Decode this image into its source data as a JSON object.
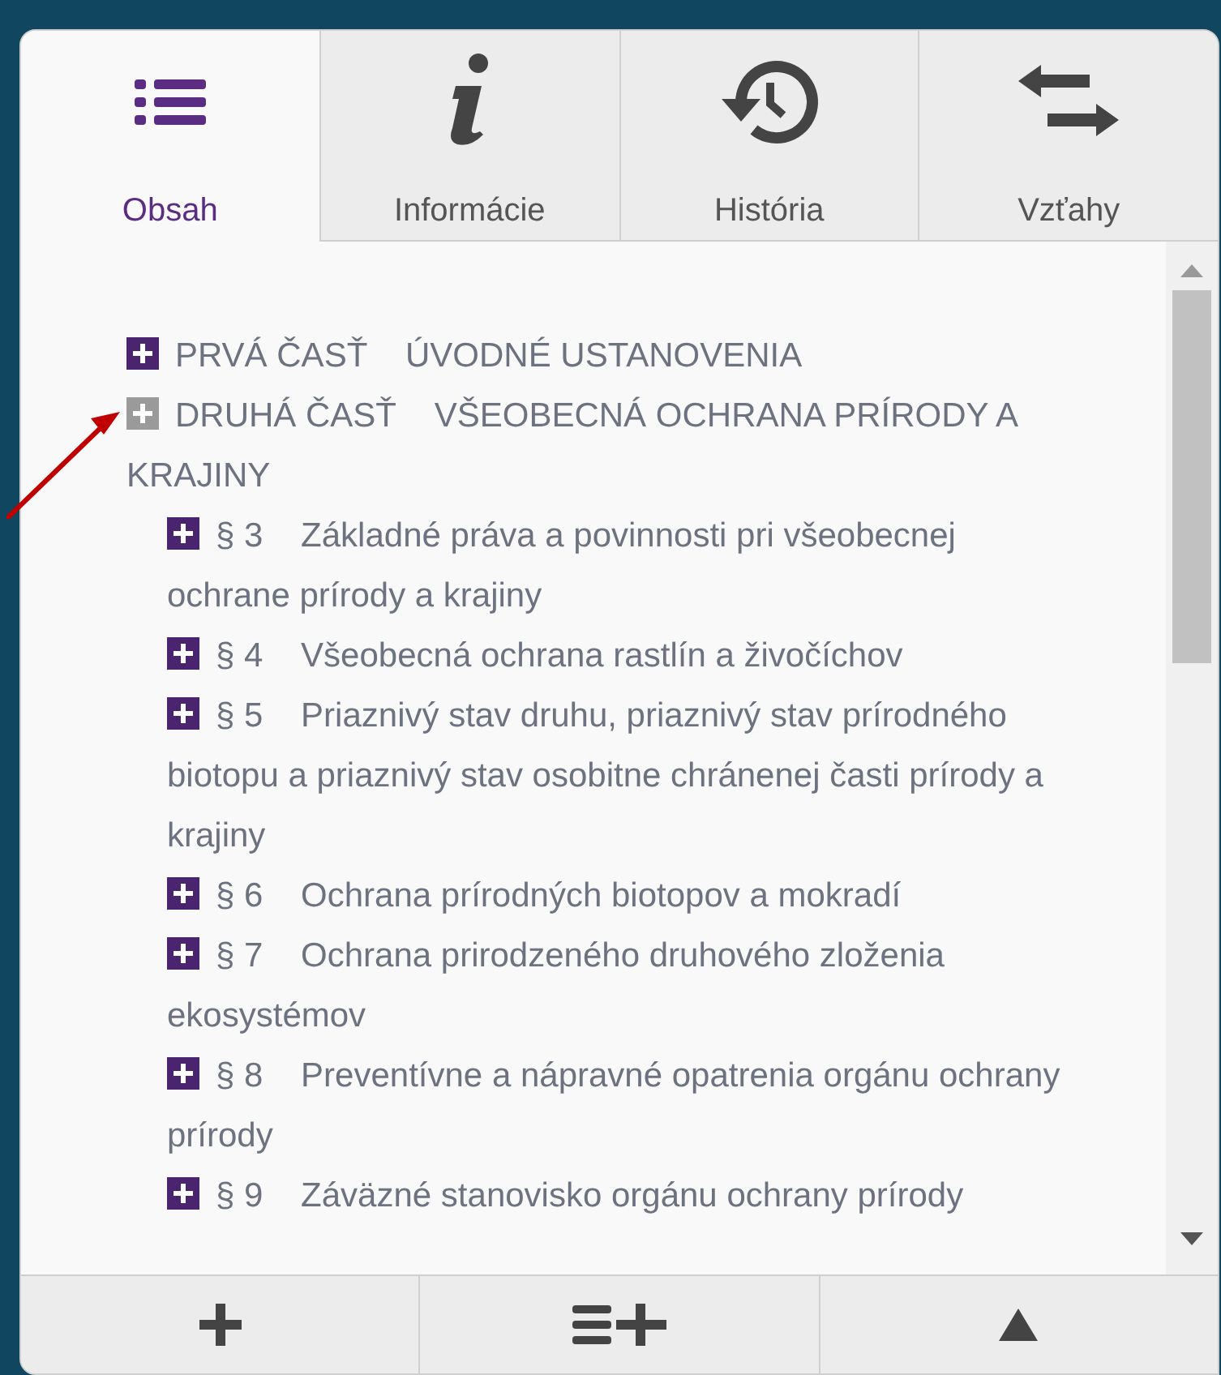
{
  "tabs": [
    {
      "label": "Obsah",
      "kind": "list",
      "selected": true
    },
    {
      "label": "Informácie",
      "kind": "info",
      "selected": false
    },
    {
      "label": "História",
      "kind": "history",
      "selected": false
    },
    {
      "label": "Vzťahy",
      "kind": "relations",
      "selected": false
    }
  ],
  "tree": [
    {
      "number": "PRVÁ ČASŤ",
      "title": "ÚVODNÉ USTANOVENIA",
      "expanded": false
    },
    {
      "number": "DRUHÁ ČASŤ",
      "title": "VŠEOBECNÁ OCHRANA PRÍRODY A KRAJINY",
      "expanded": true,
      "children": [
        {
          "number": "§ 3",
          "title": "Základné práva a povinnosti pri všeobecnej ochrane prírody a krajiny",
          "expanded": false
        },
        {
          "number": "§ 4",
          "title": "Všeobecná ochrana rastlín a živočíchov",
          "expanded": false
        },
        {
          "number": "§ 5",
          "title": "Priaznivý stav druhu, priaznivý stav prírodného biotopu a priaznivý stav osobitne chránenej časti prírody a krajiny",
          "expanded": false
        },
        {
          "number": "§ 6",
          "title": "Ochrana prírodných biotopov a mokradí",
          "expanded": false
        },
        {
          "number": "§ 7",
          "title": "Ochrana prirodzeného druhového zloženia ekosystémov",
          "expanded": false
        },
        {
          "number": "§ 8",
          "title": "Preventívne a nápravné opatrenia orgánu ochrany prírody",
          "expanded": false
        },
        {
          "number": "§ 9",
          "title": "Záväzné stanovisko orgánu ochrany prírody",
          "expanded": false
        }
      ]
    }
  ],
  "toolbar": [
    {
      "kind": "add"
    },
    {
      "kind": "add-list"
    },
    {
      "kind": "up"
    }
  ]
}
